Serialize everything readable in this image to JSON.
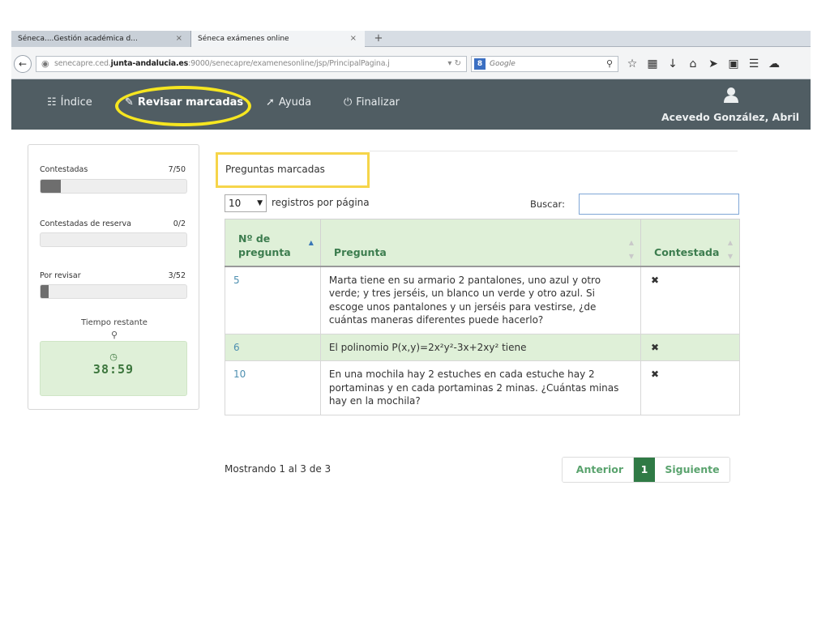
{
  "browser": {
    "tabs": [
      {
        "label": "Séneca....Gestión académica d...",
        "close": "×"
      },
      {
        "label": "Séneca exámenes online",
        "close": "×"
      }
    ],
    "new_tab": "+",
    "url_prefix": "senecapre.ced.",
    "url_domain": "junta-andalucia.es",
    "url_rest": ":9000/senecapre/examenesonline/jsp/PrincipalPagina.j",
    "search_engine": "Google"
  },
  "header": {
    "menu": [
      {
        "label": "Índice",
        "icon": "sitemap-icon"
      },
      {
        "label": "Revisar marcadas",
        "icon": "pencil-icon"
      },
      {
        "label": "Ayuda",
        "icon": "info-icon"
      },
      {
        "label": "Finalizar",
        "icon": "power-icon"
      }
    ],
    "user_name": "Acevedo González, Abril",
    "color": "#505d63"
  },
  "stats": {
    "answered": {
      "label": "Contestadas",
      "count": "7/50",
      "fraction": 0.14
    },
    "reserve": {
      "label": "Contestadas de reserva",
      "count": "0/2",
      "fraction": 0
    },
    "review": {
      "label": "Por revisar",
      "count": "3/52",
      "fraction": 0.058
    },
    "time_label": "Tiempo restante",
    "time_value": "38:59"
  },
  "content": {
    "title": "Preguntas marcadas",
    "page_length": "10",
    "page_length_label": "registros por página",
    "search_label": "Buscar:",
    "search_value": "",
    "table": {
      "headers": [
        "Nº de pregunta",
        "Pregunta",
        "Contestada"
      ],
      "rows": [
        {
          "num": "5",
          "question": "Marta tiene en su armario 2 pantalones, uno azul y otro verde; y tres jerséis, un blanco un verde y otro azul. Si escoge unos pantalones y un jerséis para vestirse, ¿de cuántas maneras diferentes puede hacerlo?",
          "answered": "✖"
        },
        {
          "num": "6",
          "question": "El polinomio P(x,y)=2x²y²-3x+2xy² tiene",
          "answered": "✖"
        },
        {
          "num": "10",
          "question": "En una mochila hay 2 estuches en cada estuche hay 2 portaminas y en cada portaminas 2 minas. ¿Cuántas minas hay en la mochila?",
          "answered": "✖"
        }
      ]
    },
    "info": "Mostrando 1 al 3 de 3",
    "pager": {
      "prev": "Anterior",
      "current": "1",
      "next": "Siguiente"
    }
  },
  "colors": {
    "accent_green": "#dff0d8",
    "highlight_yellow": "#f6e620",
    "pager_active": "#2f7a45"
  }
}
